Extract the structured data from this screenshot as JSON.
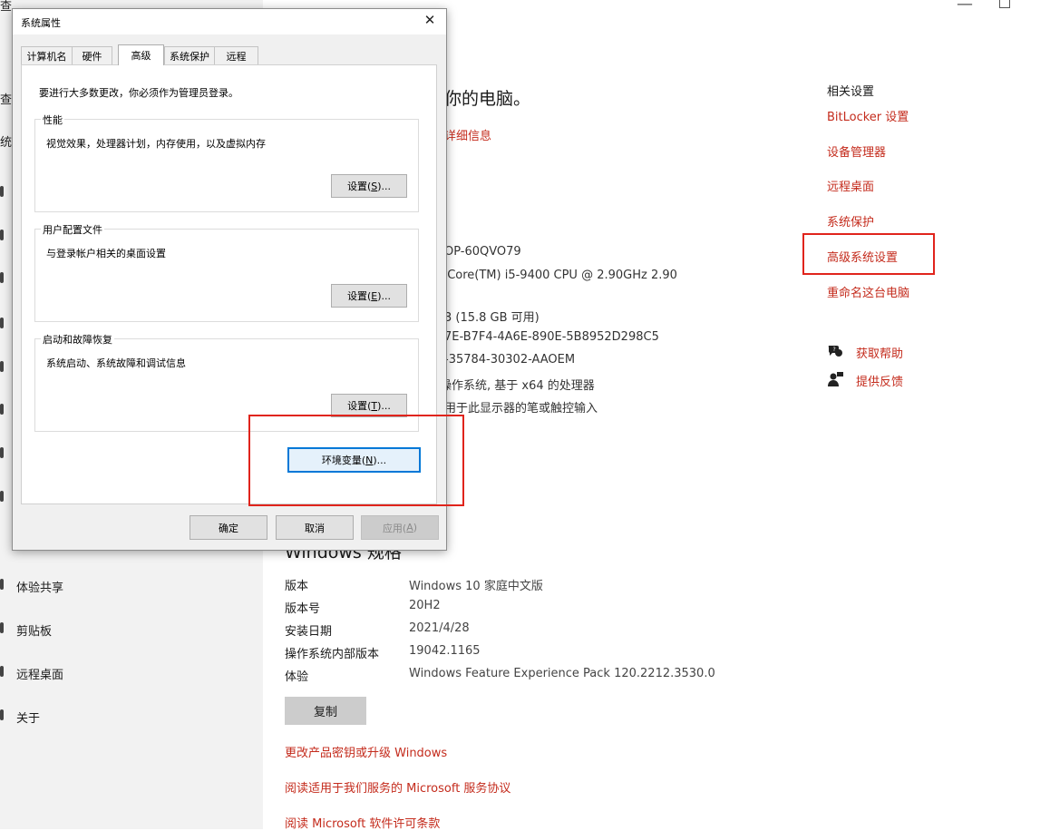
{
  "sidebar": {
    "fragments": [
      "查",
      "统"
    ],
    "items": [
      {
        "label": "体验共享"
      },
      {
        "label": "剪贴板"
      },
      {
        "label": "远程桌面"
      },
      {
        "label": "关于"
      }
    ]
  },
  "main": {
    "title_fragment": "你的电脑。",
    "details_link_fragment": "详细信息",
    "device_fragments": [
      "OP-60QVO79",
      ") Core(TM) i5-9400 CPU @ 2.90GHz   2.90",
      "3 (15.8 GB 可用)",
      "7E-B7F4-4A6E-890E-5B8952D298C5",
      "-35784-30302-AAOEM",
      "操作系统, 基于 x64 的处理器",
      "用于此显示器的笔或触控输入"
    ]
  },
  "related_settings": {
    "heading": "相关设置",
    "links": [
      "BitLocker 设置",
      "设备管理器",
      "远程桌面",
      "系统保护",
      "高级系统设置",
      "重命名这台电脑"
    ],
    "help_label": "获取帮助",
    "feedback_label": "提供反馈"
  },
  "windows_spec": {
    "heading": "Windows 规格",
    "rows": [
      {
        "label": "版本",
        "value": "Windows 10 家庭中文版"
      },
      {
        "label": "版本号",
        "value": "20H2"
      },
      {
        "label": "安装日期",
        "value": "2021/4/28"
      },
      {
        "label": "操作系统内部版本",
        "value": "19042.1165"
      },
      {
        "label": "体验",
        "value": "Windows Feature Experience Pack 120.2212.3530.0"
      }
    ],
    "copy_button": "复制",
    "links": [
      "更改产品密钥或升级 Windows",
      "阅读适用于我们服务的 Microsoft 服务协议",
      "阅读 Microsoft 软件许可条款"
    ]
  },
  "dialog": {
    "title": "系统属性",
    "tabs": [
      "计算机名",
      "硬件",
      "高级",
      "系统保护",
      "远程"
    ],
    "active_tab": "高级",
    "admin_note": "要进行大多数更改，你必须作为管理员登录。",
    "performance": {
      "label": "性能",
      "desc": "视觉效果，处理器计划，内存使用，以及虚拟内存",
      "btn_text": "设置(",
      "btn_key": "S",
      "btn_tail": ")..."
    },
    "user_profiles": {
      "label": "用户配置文件",
      "desc": "与登录帐户相关的桌面设置",
      "btn_text": "设置(",
      "btn_key": "E",
      "btn_tail": ")..."
    },
    "startup": {
      "label": "启动和故障恢复",
      "desc": "系统启动、系统故障和调试信息",
      "btn_text": "设置(",
      "btn_key": "T",
      "btn_tail": ")..."
    },
    "env_button": {
      "text": "环境变量(",
      "key": "N",
      "tail": ")..."
    },
    "ok": "确定",
    "cancel": "取消",
    "apply_text": "应用(",
    "apply_key": "A",
    "apply_tail": ")"
  },
  "colors": {
    "accent_link": "#c42b1c",
    "highlight": "#e0241c",
    "focus": "#0078d7"
  }
}
